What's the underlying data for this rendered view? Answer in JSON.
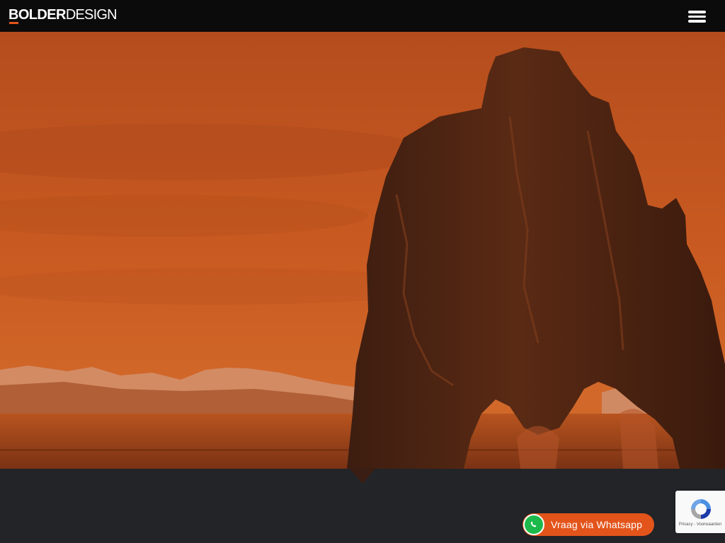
{
  "header": {
    "logo": {
      "bold": "BOLDER",
      "light": "DESIGN"
    },
    "menu_icon": "hamburger-menu-icon"
  },
  "hero": {
    "image": "orange-tinted-sea-stack-photo"
  },
  "whatsapp": {
    "label": "Vraag via Whatsapp",
    "icon": "whatsapp-icon"
  },
  "recaptcha": {
    "links": "Privacy - Voorwaarden"
  },
  "colors": {
    "accent": "#e3541b",
    "header_bg": "#0b0b0b",
    "section_bg": "#222428",
    "whatsapp_green": "#1dba4b"
  }
}
